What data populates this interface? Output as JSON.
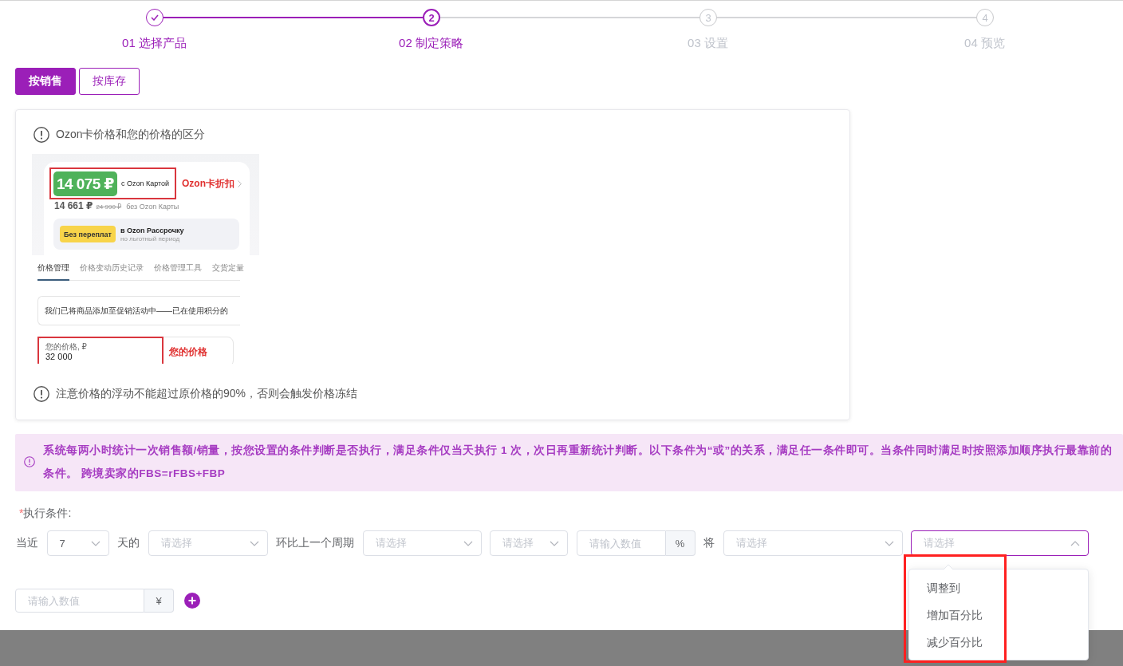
{
  "steps": [
    {
      "label": "01 选择产品",
      "completed": true,
      "selected": false
    },
    {
      "number": "2",
      "label": "02 制定策略",
      "completed": false,
      "selected": true
    },
    {
      "number": "3",
      "label": "03 设置",
      "completed": false,
      "selected": false
    },
    {
      "number": "4",
      "label": "04 预览",
      "completed": false,
      "selected": false
    }
  ],
  "strategy_tabs": [
    {
      "label": "按销售",
      "selected": true
    },
    {
      "label": "按库存",
      "selected": false
    }
  ],
  "guide_card": {
    "title": "Ozon卡价格和您的价格的区分",
    "example_screenshot": {
      "card_price": "14 075 ₽",
      "card_price_caption": "с Ozon Картой",
      "card_price_note": "Ozon卡折扣",
      "regular_price": "14 661 ₽",
      "old_price": "24 990 ₽",
      "regular_price_caption": "без Ozon Карты",
      "installment_badge": "Без переплат",
      "installment_title": "в Ozon Рассрочку",
      "installment_subtitle": "но льготный период",
      "tabs": [
        {
          "label": "价格管理",
          "selected": true
        },
        {
          "label": "价格变动历史记录",
          "selected": false
        },
        {
          "label": "价格管理工具",
          "selected": false
        },
        {
          "label": "交货定量",
          "selected": false
        }
      ],
      "notice": "我们已将商品添加至促销活动中——已在使用积分的",
      "price_field": {
        "label": "您的价格, ₽",
        "value": "32 000"
      },
      "price_note": "您的价格"
    },
    "warning": "注意价格的浮动不能超过原价格的90%，否则会触发价格冻结"
  },
  "notice_banner": {
    "text": "系统每两小时统计一次销售额/销量，按您设置的条件判断是否执行，满足条件仅当天执行 1 次，次日再重新统计判断。以下条件为“或”的关系，满足任一条件即可。当条件同时满足时按照添加顺序执行最靠前的条件。 跨境卖家的FBS=rFBS+FBP"
  },
  "conditions": {
    "required_mark": "*",
    "label": "执行条件:",
    "row": [
      {
        "kind": "text",
        "text": "当近"
      },
      {
        "kind": "select",
        "value": "7",
        "expanded": false
      },
      {
        "kind": "text",
        "text": "天的"
      },
      {
        "kind": "select",
        "placeholder": "请选择",
        "expanded": false
      },
      {
        "kind": "text",
        "text": "环比上一个周期"
      },
      {
        "kind": "select",
        "placeholder": "请选择",
        "expanded": false
      },
      {
        "kind": "select",
        "placeholder": "请选择",
        "expanded": false
      },
      {
        "kind": "input",
        "placeholder": "请输入数值",
        "suffix": "%"
      },
      {
        "kind": "text",
        "text": "将"
      },
      {
        "kind": "select",
        "placeholder": "请选择",
        "expanded": false
      },
      {
        "kind": "select",
        "placeholder": "请选择",
        "expanded": true,
        "options": [
          {
            "label": "调整到",
            "selected": false
          },
          {
            "label": "增加百分比",
            "selected": false
          },
          {
            "label": "减少百分比",
            "selected": false
          }
        ]
      }
    ],
    "amount_field": {
      "placeholder": "请输入数值",
      "suffix": "¥"
    }
  }
}
